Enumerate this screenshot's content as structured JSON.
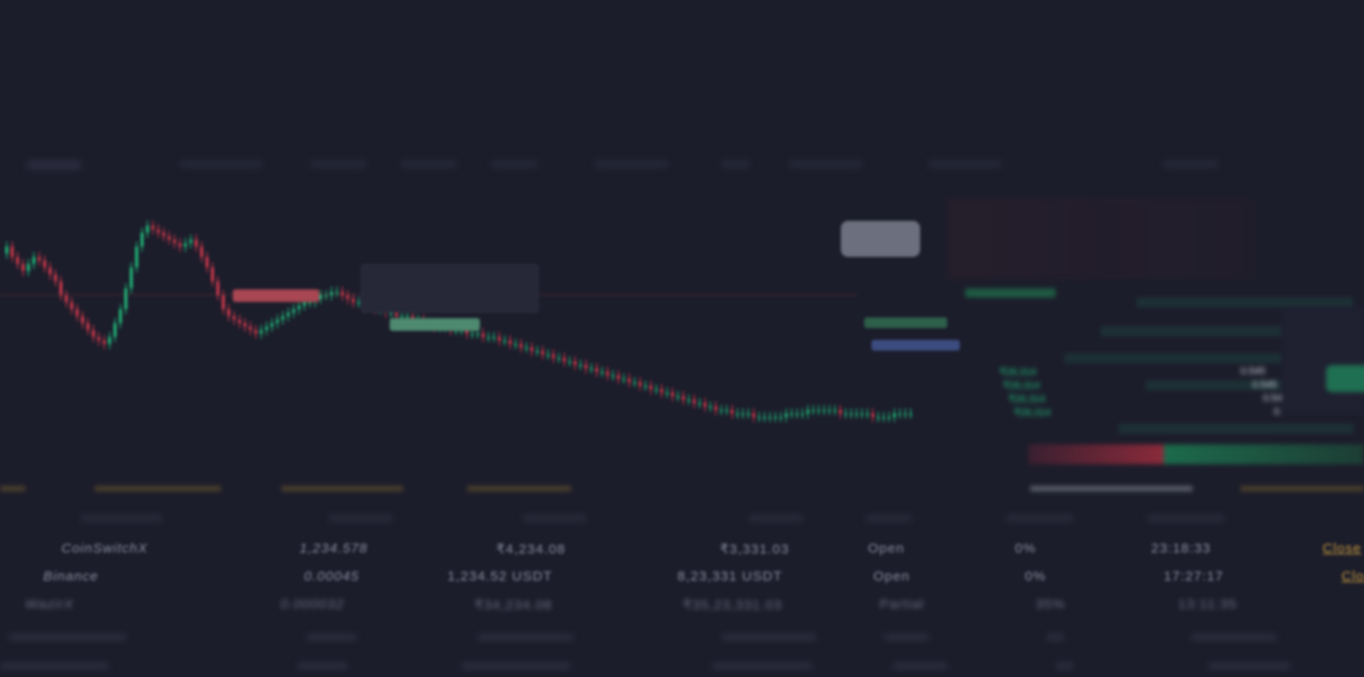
{
  "colors": {
    "background": "#1c1d2b",
    "up": "#1fc981",
    "down": "#e23b4f",
    "accent": "#c79a3d",
    "text": "#cfd3dc"
  },
  "orderbook": {
    "bids": [
      {
        "price": "₹26,314",
        "size": "0.545"
      },
      {
        "price": "₹26,314",
        "size": "0.545"
      },
      {
        "price": "₹26,314",
        "size": "0.545"
      },
      {
        "price": "₹26,314",
        "size": "0.545"
      }
    ]
  },
  "orders": {
    "rows": [
      {
        "exchange": "CoinSwitchX",
        "quantity": "1,234.578",
        "amount": "₹4,234.08",
        "total": "₹3,331.03",
        "status": "Open",
        "progress": "0%",
        "time": "23:18:33",
        "action": "Close"
      },
      {
        "exchange": "Binance",
        "quantity": "0.00045",
        "amount": "1,234.52 USDT",
        "total": "8,23,331 USDT",
        "status": "Open",
        "progress": "0%",
        "time": "17:27:17",
        "action": "Close"
      },
      {
        "exchange": "WazirX",
        "quantity": "0.000032",
        "amount": "₹34,234.08",
        "total": "₹35,23,331.03",
        "status": "Partial",
        "progress": "35%",
        "time": "13:11:35",
        "action": ""
      }
    ]
  },
  "chart_data": {
    "type": "candlestick",
    "x": [],
    "series": [
      {
        "values": [
          58,
          60,
          57,
          55,
          53,
          55,
          57,
          56,
          54,
          52,
          50,
          46,
          44,
          42,
          40,
          38,
          36,
          34,
          33,
          32,
          34,
          38,
          42,
          48,
          54,
          60,
          64,
          66,
          65,
          64,
          63,
          62,
          61,
          60,
          61,
          62,
          60,
          57,
          54,
          50,
          46,
          42,
          40,
          39,
          38,
          37,
          36,
          35,
          36,
          37,
          38,
          39,
          40,
          41,
          42,
          43,
          44,
          44,
          45,
          46,
          46,
          47,
          47,
          46,
          45,
          44,
          44,
          43,
          43,
          42,
          42,
          41,
          41,
          40,
          40,
          40,
          39,
          39,
          38,
          38,
          37,
          37,
          37,
          36,
          36,
          36,
          35,
          35,
          35,
          34,
          34,
          34,
          33,
          33,
          32,
          32,
          31,
          31,
          30,
          30,
          29,
          29,
          28,
          28,
          27,
          27,
          26,
          26,
          25,
          25,
          24,
          24,
          23,
          23,
          22,
          22,
          21,
          21,
          20,
          20,
          19,
          19,
          18,
          18,
          17,
          17,
          16,
          16,
          15,
          15,
          14,
          14,
          13,
          13,
          13,
          12,
          12,
          12,
          12,
          11,
          11,
          11,
          11,
          11,
          11,
          12,
          12,
          12,
          12,
          13,
          13,
          13,
          13,
          13,
          13,
          12,
          12,
          12,
          12,
          12,
          12,
          11,
          11,
          11,
          11,
          12,
          12,
          12,
          12
        ]
      }
    ]
  }
}
